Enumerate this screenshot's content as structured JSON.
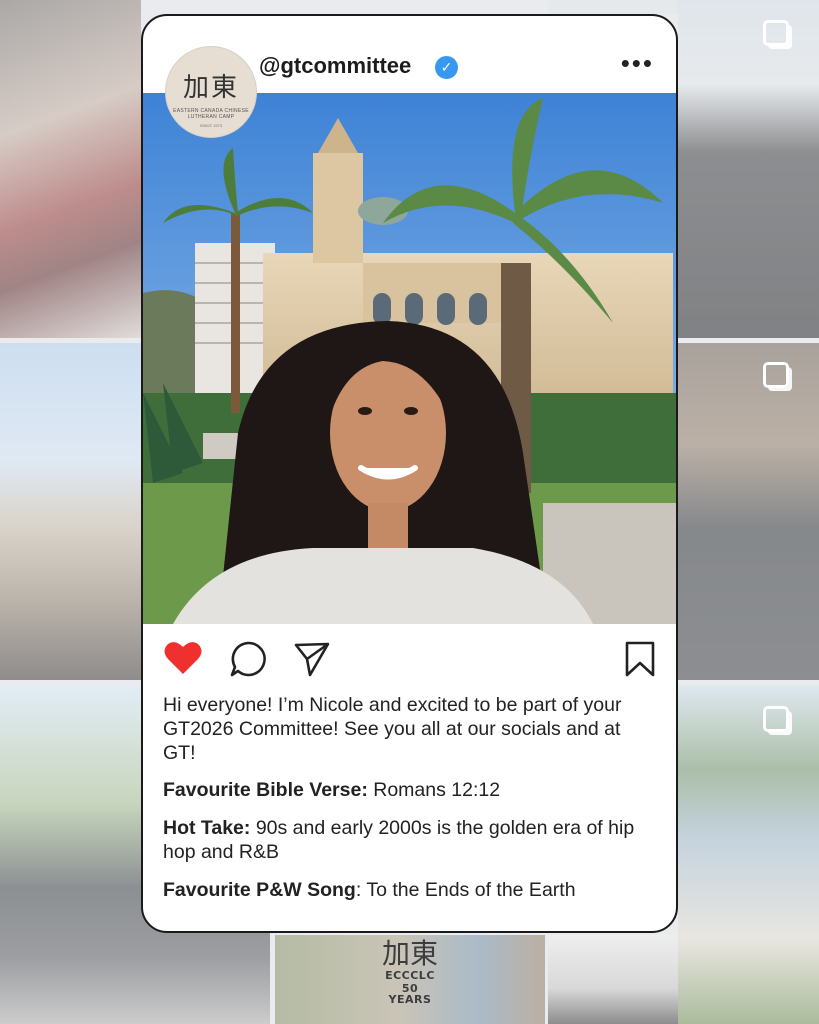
{
  "post": {
    "username": "@gtcommittee",
    "verified_mark": "✓",
    "more_glyph": "•••",
    "avatar": {
      "icon": "committee-logo",
      "cjk": "加東",
      "tagline": "EASTERN CANADA CHINESE LUTHERAN CAMP",
      "since": "SINCE 1973"
    },
    "photo_description_icon": "profile-photo",
    "actions": {
      "like_icon": "heart-icon",
      "like_color": "#f0302f",
      "comment_icon": "comment-icon",
      "share_icon": "send-icon",
      "save_icon": "bookmark-icon"
    },
    "caption": {
      "intro": "Hi everyone! I’m Nicole and excited to be part of your GT2026 Committee! See you all at our socials and at GT!",
      "facts": [
        {
          "label": "Favourite Bible Verse:",
          "value": " Romans 12:12"
        },
        {
          "label": "Hot Take:",
          "value": " 90s and early 2000s is the golden era of hip hop and R&B"
        },
        {
          "label": "Favourite P&W Song",
          "value": ": To the Ends of the Earth"
        }
      ]
    }
  },
  "background": {
    "logo_cjk": "加東",
    "logo_name": "ECCCLC",
    "logo_years": "50 YEARS"
  },
  "colors": {
    "accent_blue": "#3897f0",
    "heart_red": "#f0302f",
    "card_border": "#1a1a1a"
  }
}
